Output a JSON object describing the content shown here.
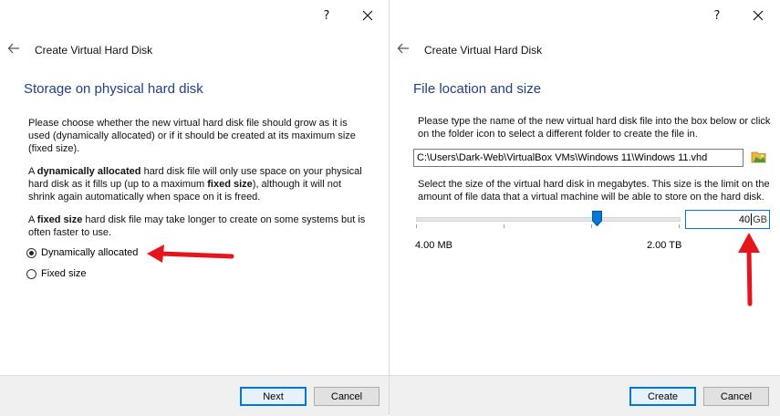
{
  "left_dialog": {
    "help_label": "?",
    "wizard_title": "Create Virtual Hard Disk",
    "heading": "Storage on physical hard disk",
    "para1": "Please choose whether the new virtual hard disk file should grow as it is used (dynamically allocated) or if it should be created at its maximum size (fixed size).",
    "para2_prefix": "A ",
    "para2_bold1": "dynamically allocated",
    "para2_mid": " hard disk file will only use space on your physical hard disk as it fills up (up to a maximum ",
    "para2_bold2": "fixed size",
    "para2_suffix": "), although it will not shrink again automatically when space on it is freed.",
    "para3_prefix": "A ",
    "para3_bold": "fixed size",
    "para3_suffix": " hard disk file may take longer to create on some systems but is often faster to use.",
    "options": [
      {
        "label": "Dynamically allocated",
        "checked": true
      },
      {
        "label": "Fixed size",
        "checked": false
      }
    ],
    "next_label": "Next",
    "cancel_label": "Cancel"
  },
  "right_dialog": {
    "help_label": "?",
    "wizard_title": "Create Virtual Hard Disk",
    "heading": "File location and size",
    "para1": "Please type the name of the new virtual hard disk file into the box below or click on the folder icon to select a different folder to create the file in.",
    "file_path": "C:\\Users\\Dark-Web\\VirtualBox VMs\\Windows 11\\Windows 11.vhd",
    "para2": "Select the size of the virtual hard disk in megabytes. This size is the limit on the amount of file data that a virtual machine will be able to store on the hard disk.",
    "slider_min_label": "4.00 MB",
    "slider_max_label": "2.00 TB",
    "size_value": "40",
    "size_unit": "GB",
    "create_label": "Create",
    "cancel_label": "Cancel"
  },
  "colors": {
    "heading": "#1e3f8a",
    "accent": "#0078d7",
    "annotation_arrow": "#e8141c"
  }
}
